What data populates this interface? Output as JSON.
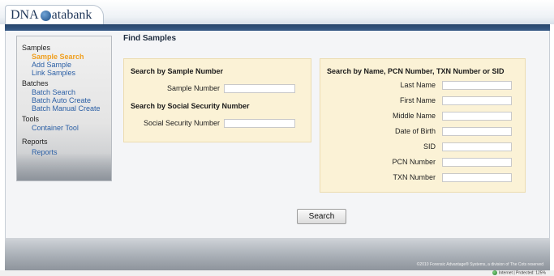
{
  "brand": {
    "logo_text_pre": "DNA",
    "logo_text_post": "atabank",
    "logo_icon": "dna-swirl-icon"
  },
  "sidebar": {
    "groups": [
      {
        "label": "Samples",
        "items": [
          {
            "label": "Sample Search",
            "active": true
          },
          {
            "label": "Add Sample",
            "active": false
          },
          {
            "label": "Link Samples",
            "active": false
          }
        ]
      },
      {
        "label": "Batches",
        "items": [
          {
            "label": "Batch Search",
            "active": false
          },
          {
            "label": "Batch Auto Create",
            "active": false
          },
          {
            "label": "Batch Manual Create",
            "active": false
          }
        ]
      },
      {
        "label": "Tools",
        "items": [
          {
            "label": "Container Tool",
            "active": false
          }
        ]
      },
      {
        "label": "Reports",
        "items": [
          {
            "label": "Reports",
            "active": false
          }
        ]
      }
    ]
  },
  "main": {
    "title": "Find Samples",
    "left_panel": {
      "heading_sample": "Search by Sample Number",
      "sample_number_label": "Sample Number",
      "sample_number_value": "",
      "heading_ssn": "Search by Social Security Number",
      "ssn_label": "Social Security Number",
      "ssn_value": ""
    },
    "right_panel": {
      "heading": "Search by Name, PCN Number, TXN Number or SID",
      "fields": [
        {
          "label": "Last Name",
          "value": ""
        },
        {
          "label": "First Name",
          "value": ""
        },
        {
          "label": "Middle Name",
          "value": ""
        },
        {
          "label": "Date of Birth",
          "value": ""
        },
        {
          "label": "SID",
          "value": ""
        },
        {
          "label": "PCN Number",
          "value": ""
        },
        {
          "label": "TXN Number",
          "value": ""
        }
      ]
    },
    "search_button": "Search"
  },
  "footer": {
    "copyright": "©2010 Forensic Advantage® Systems, a division of The Cots reserved",
    "status_zone": "Internet | Protected: 125%"
  },
  "colors": {
    "nav_bar": "#26446b",
    "panel_bg": "#fbf2d6",
    "active_link": "#f0a020",
    "link": "#2b5fa5"
  }
}
